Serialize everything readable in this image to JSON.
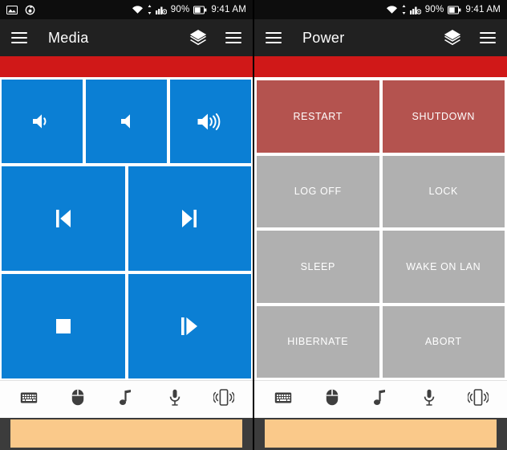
{
  "status_bar": {
    "left_icons": [
      "photo-icon",
      "sync-icon"
    ],
    "wifi_icon": "wifi-icon",
    "signal_icon": "cell-signal-icon",
    "battery_percent": "90%",
    "battery_icon": "battery-icon",
    "time": "9:41 AM"
  },
  "colors": {
    "accent_red": "#d01818",
    "tile_blue": "#0b7fd4",
    "tile_red": "#b4534f",
    "tile_gray": "#b0b0b0",
    "appbar": "#212121",
    "statusbar": "#0d0d0d",
    "touchpad": "#fac98a"
  },
  "screens": [
    {
      "id": "media",
      "appbar": {
        "menu_icon": "hamburger-menu-icon",
        "title": "Media",
        "layers_icon": "layers-icon",
        "overflow_icon": "overflow-menu-icon"
      },
      "tiles": [
        {
          "name": "volume-down",
          "icon": "volume-down-icon",
          "label": "",
          "color": "#0b7fd4"
        },
        {
          "name": "volume-mute",
          "icon": "volume-mute-icon",
          "label": "",
          "color": "#0b7fd4"
        },
        {
          "name": "volume-up",
          "icon": "volume-up-icon",
          "label": "",
          "color": "#0b7fd4"
        },
        {
          "name": "previous-track",
          "icon": "previous-track-icon",
          "label": "",
          "color": "#0b7fd4"
        },
        {
          "name": "next-track",
          "icon": "next-track-icon",
          "label": "",
          "color": "#0b7fd4"
        },
        {
          "name": "stop",
          "icon": "stop-icon",
          "label": "",
          "color": "#0b7fd4"
        },
        {
          "name": "play-pause",
          "icon": "play-pause-icon",
          "label": "",
          "color": "#0b7fd4"
        }
      ]
    },
    {
      "id": "power",
      "appbar": {
        "menu_icon": "hamburger-menu-icon",
        "title": "Power",
        "layers_icon": "layers-icon",
        "overflow_icon": "overflow-menu-icon"
      },
      "tiles": [
        {
          "name": "restart",
          "label": "RESTART",
          "color": "#b4534f"
        },
        {
          "name": "shutdown",
          "label": "SHUTDOWN",
          "color": "#b4534f"
        },
        {
          "name": "log-off",
          "label": "LOG OFF",
          "color": "#b0b0b0"
        },
        {
          "name": "lock",
          "label": "LOCK",
          "color": "#b0b0b0"
        },
        {
          "name": "sleep",
          "label": "SLEEP",
          "color": "#b0b0b0"
        },
        {
          "name": "wake-on-lan",
          "label": "WAKE ON LAN",
          "color": "#b0b0b0"
        },
        {
          "name": "hibernate",
          "label": "HIBERNATE",
          "color": "#b0b0b0"
        },
        {
          "name": "abort",
          "label": "ABORT",
          "color": "#b0b0b0"
        }
      ]
    }
  ],
  "bottom_nav": [
    {
      "name": "keyboard",
      "icon": "keyboard-icon"
    },
    {
      "name": "mouse",
      "icon": "mouse-icon"
    },
    {
      "name": "media",
      "icon": "music-note-icon"
    },
    {
      "name": "voice",
      "icon": "microphone-icon"
    },
    {
      "name": "device",
      "icon": "vibrate-phone-icon"
    }
  ]
}
